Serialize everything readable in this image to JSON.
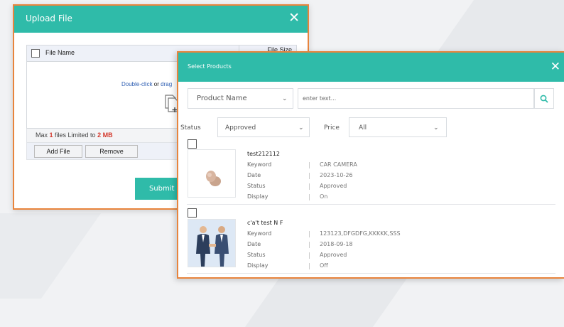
{
  "upload": {
    "title": "Upload File",
    "col_filename": "File Name",
    "col_filesize": "File Size",
    "drop_hint": {
      "double_click": "Double-click",
      "or": " or ",
      "drag": "drag"
    },
    "info": {
      "prefix": "Max ",
      "max_files": "1",
      "mid": " files Limited to ",
      "limit": "2 MB"
    },
    "add_button": "Add File",
    "remove_button": "Remove",
    "submit_button": "Submit"
  },
  "select": {
    "title": "Select Products",
    "search": {
      "field_selected": "Product Name",
      "placeholder": "enter text..."
    },
    "filters": {
      "status_label": "Status",
      "status_value": "Approved",
      "price_label": "Price",
      "price_value": "All"
    },
    "field_labels": {
      "keyword": "Keyword",
      "date": "Date",
      "status": "Status",
      "display": "Display"
    },
    "products": [
      {
        "name": "test212112",
        "keyword": "CAR CAMERA",
        "date": "2023-10-26",
        "status": "Approved",
        "display": "On",
        "thumb_icon": "round-product-icon"
      },
      {
        "name": "c'a't test N F",
        "keyword": "123123,DFGDFG,KKKKK,SSS",
        "date": "2018-09-18",
        "status": "Approved",
        "display": "Off",
        "thumb_icon": "handshake-icon"
      }
    ]
  },
  "colors": {
    "teal": "#2fbba9",
    "orange_border": "#e8843c",
    "red": "#d43a2e"
  }
}
